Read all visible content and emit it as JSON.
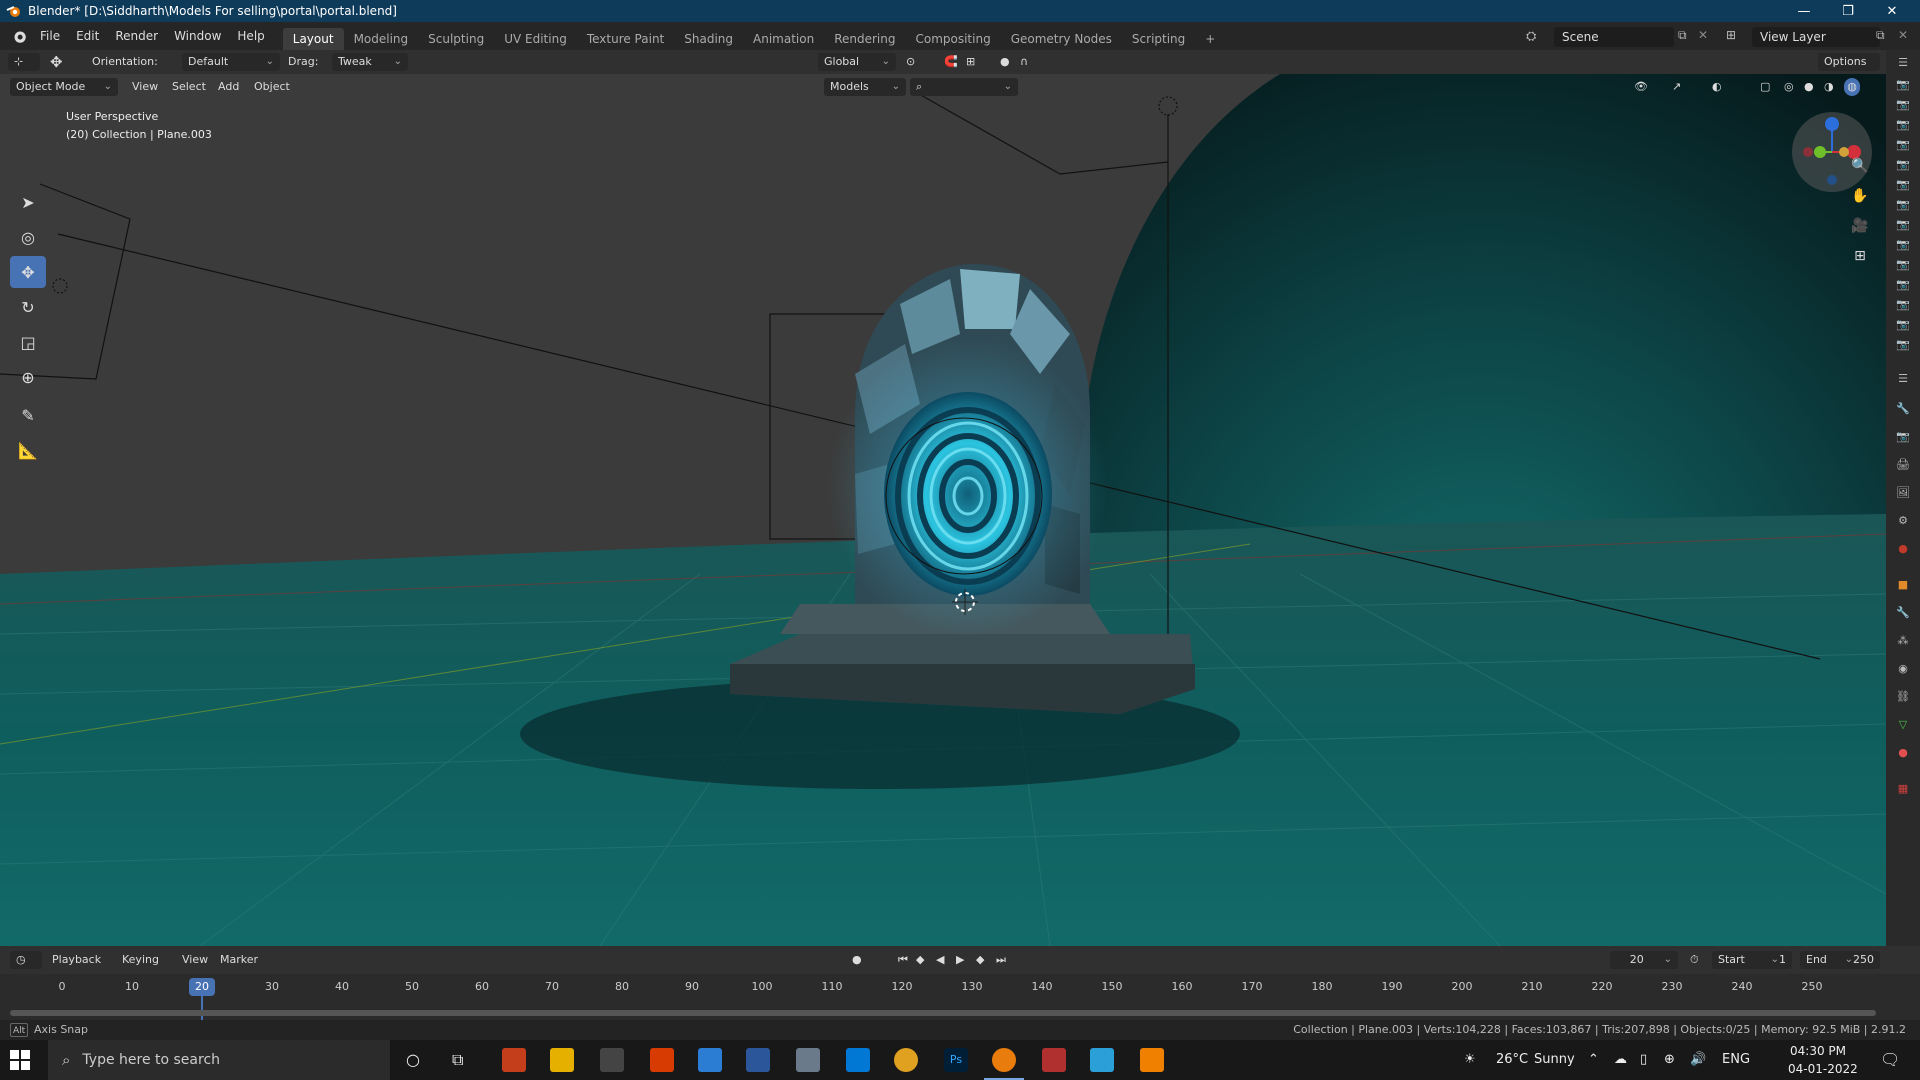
{
  "window": {
    "title": "Blender* [D:\\Siddharth\\Models For selling\\portal\\portal.blend]",
    "controls": [
      "—",
      "❐",
      "✕"
    ]
  },
  "menu": {
    "items": [
      "File",
      "Edit",
      "Render",
      "Window",
      "Help"
    ],
    "workspaces": [
      "Layout",
      "Modeling",
      "Sculpting",
      "UV Editing",
      "Texture Paint",
      "Shading",
      "Animation",
      "Rendering",
      "Compositing",
      "Geometry Nodes",
      "Scripting",
      "+"
    ],
    "active_workspace": "Layout",
    "scene": "Scene",
    "view_layer": "View Layer"
  },
  "tool_header": {
    "orientation_label": "Orientation:",
    "orientation_value": "Default",
    "drag_label": "Drag:",
    "drag_value": "Tweak",
    "transform_orientation": "Global",
    "options": "Options"
  },
  "viewport_header": {
    "mode": "Object Mode",
    "menus": [
      "View",
      "Select",
      "Add",
      "Object"
    ],
    "models_filter": "Models"
  },
  "viewport": {
    "perspective": "User Perspective",
    "collection_info": "(20) Collection | Plane.003"
  },
  "tools": [
    "select-box",
    "cursor",
    "move",
    "rotate",
    "scale",
    "transform",
    "annotate",
    "measure"
  ],
  "active_tool": "move",
  "timeline": {
    "menus": [
      "Playback",
      "Keying",
      "View",
      "Marker"
    ],
    "current_frame": "20",
    "start_label": "Start",
    "start": "1",
    "end_label": "End",
    "end": "250",
    "ticks": [
      "0",
      "10",
      "20",
      "30",
      "40",
      "50",
      "60",
      "70",
      "80",
      "90",
      "100",
      "110",
      "120",
      "130",
      "140",
      "150",
      "160",
      "170",
      "180",
      "190",
      "200",
      "210",
      "220",
      "230",
      "240",
      "250"
    ]
  },
  "statusbar": {
    "left": "Axis Snap",
    "key": "Alt",
    "right": "Collection | Plane.003 | Verts:104,228 | Faces:103,867 | Tris:207,898 | Objects:0/25 | Memory: 92.5 MiB | 2.91.2"
  },
  "taskbar": {
    "search_placeholder": "Type here to search",
    "weather_temp": "26°C",
    "weather_text": "Sunny",
    "lang": "ENG",
    "time": "04:30 PM",
    "date": "04-01-2022"
  },
  "colors": {
    "accent": "#4772b3",
    "titlebar": "#0f3b5a",
    "teal_floor": "#0f6363",
    "portal_glow": "#2bc4e0"
  }
}
